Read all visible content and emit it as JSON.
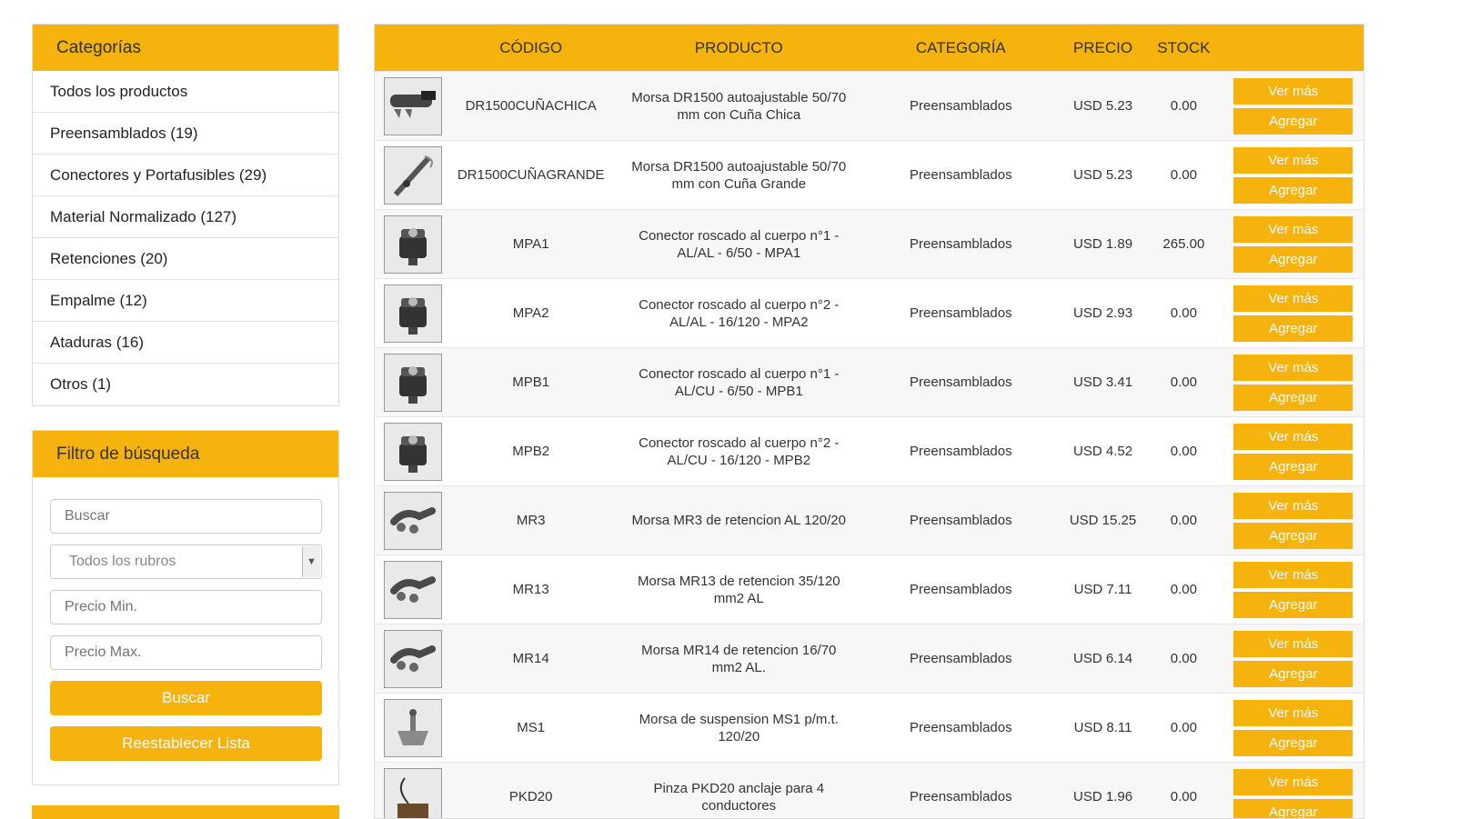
{
  "categories": {
    "title": "Categorías",
    "items": [
      "Todos los productos",
      "Preensamblados (19)",
      "Conectores y Portafusibles (29)",
      "Material Normalizado (127)",
      "Retenciones (20)",
      "Empalme (12)",
      "Ataduras (16)",
      "Otros (1)"
    ]
  },
  "filter": {
    "title": "Filtro de búsqueda",
    "search_placeholder": "Buscar",
    "rubro_selected": "Todos los rubros",
    "price_min_placeholder": "Precio Min.",
    "price_max_placeholder": "Precio Max.",
    "search_button": "Buscar",
    "reset_button": "Reestablecer Lista"
  },
  "table": {
    "headers": {
      "code": "CÓDIGO",
      "product": "PRODUCTO",
      "category": "CATEGORÍA",
      "price": "PRECIO",
      "stock": "STOCK"
    },
    "view_label": "Ver más",
    "add_label": "Agregar",
    "rows": [
      {
        "code": "DR1500CUÑACHICA",
        "product": "Morsa DR1500 autoajustable 50/70 mm con Cuña Chica",
        "category": "Preensamblados",
        "price": "USD 5.23",
        "stock": "0.00",
        "icon": "clamp-wedge-image"
      },
      {
        "code": "DR1500CUÑAGRANDE",
        "product": "Morsa DR1500 autoajustable 50/70 mm con Cuña Grande",
        "category": "Preensamblados",
        "price": "USD 5.23",
        "stock": "0.00",
        "icon": "clamp-wire-image"
      },
      {
        "code": "MPA1",
        "product": "Conector roscado al cuerpo n°1 - AL/AL - 6/50 - MPA1",
        "category": "Preensamblados",
        "price": "USD 1.89",
        "stock": "265.00",
        "icon": "connector-image"
      },
      {
        "code": "MPA2",
        "product": "Conector roscado al cuerpo n°2 - AL/AL - 16/120 - MPA2",
        "category": "Preensamblados",
        "price": "USD 2.93",
        "stock": "0.00",
        "icon": "connector-image"
      },
      {
        "code": "MPB1",
        "product": "Conector roscado al cuerpo n°1 - AL/CU - 6/50 - MPB1",
        "category": "Preensamblados",
        "price": "USD 3.41",
        "stock": "0.00",
        "icon": "connector-image"
      },
      {
        "code": "MPB2",
        "product": "Conector roscado al cuerpo n°2 - AL/CU - 16/120 - MPB2",
        "category": "Preensamblados",
        "price": "USD 4.52",
        "stock": "0.00",
        "icon": "connector-image"
      },
      {
        "code": "MR3",
        "product": "Morsa MR3 de retencion AL 120/20",
        "category": "Preensamblados",
        "price": "USD 15.25",
        "stock": "0.00",
        "icon": "retention-clamp-image"
      },
      {
        "code": "MR13",
        "product": "Morsa MR13 de retencion 35/120 mm2 AL",
        "category": "Preensamblados",
        "price": "USD 7.11",
        "stock": "0.00",
        "icon": "retention-clamp-image"
      },
      {
        "code": "MR14",
        "product": "Morsa MR14 de retencion 16/70 mm2 AL.",
        "category": "Preensamblados",
        "price": "USD 6.14",
        "stock": "0.00",
        "icon": "retention-clamp-image"
      },
      {
        "code": "MS1",
        "product": "Morsa de suspension MS1 p/m.t. 120/20",
        "category": "Preensamblados",
        "price": "USD 8.11",
        "stock": "0.00",
        "icon": "suspension-clamp-image"
      },
      {
        "code": "PKD20",
        "product": "Pinza PKD20 anclaje para 4 conductores",
        "category": "Preensamblados",
        "price": "USD 1.96",
        "stock": "0.00",
        "icon": "anchor-clamp-image"
      }
    ]
  }
}
